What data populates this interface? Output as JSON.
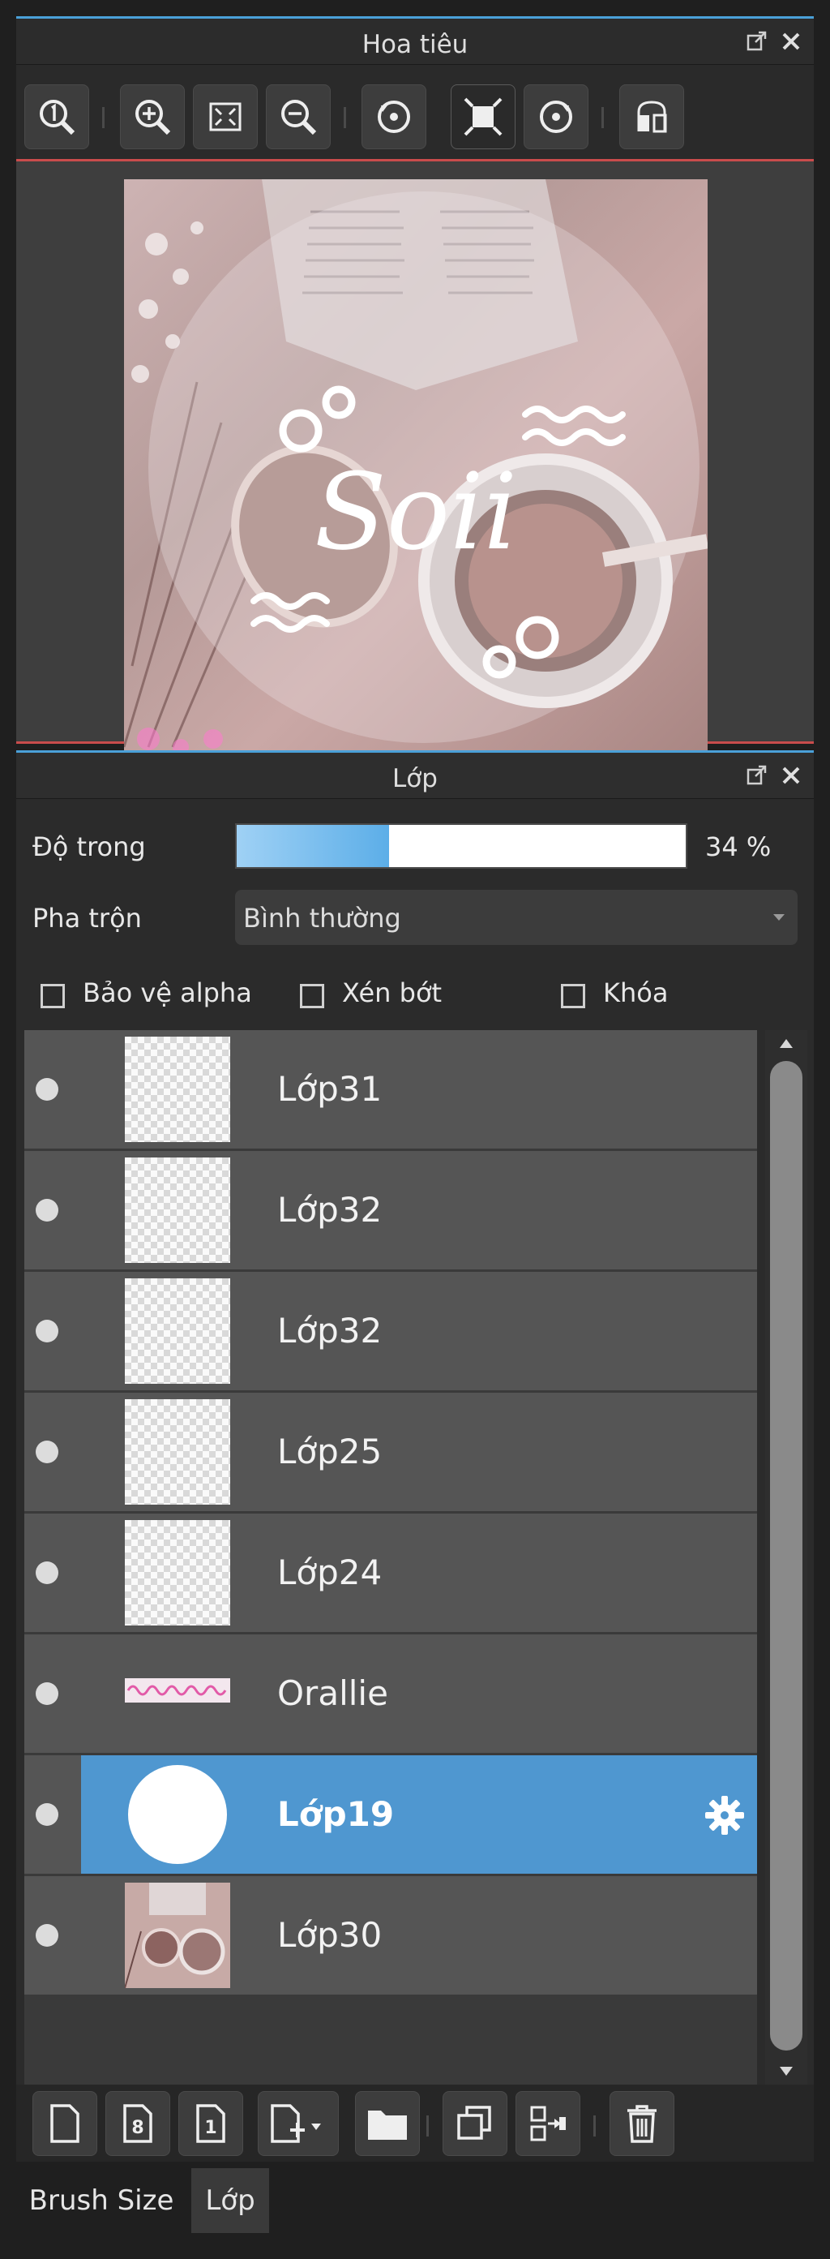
{
  "navigator": {
    "title": "Hoa tiêu",
    "preview_text": "Soii"
  },
  "layers_panel": {
    "title": "Lớp",
    "opacity_label": "Độ trong",
    "opacity_value": "34 %",
    "opacity_fraction": 0.34,
    "blend_label": "Pha trộn",
    "blend_value": "Bình thường",
    "checkboxes": [
      "Bảo vệ alpha",
      "Xén bớt",
      "Khóa"
    ],
    "layers": [
      {
        "name": "Lớp31",
        "selected": false
      },
      {
        "name": "Lớp32",
        "selected": false
      },
      {
        "name": "Lớp32",
        "selected": false
      },
      {
        "name": "Lớp25",
        "selected": false
      },
      {
        "name": "Lớp24",
        "selected": false
      },
      {
        "name": "Orallie",
        "selected": false
      },
      {
        "name": "Lớp19",
        "selected": true
      },
      {
        "name": "Lớp30",
        "selected": false
      }
    ]
  },
  "bottom_tabs": [
    "Brush Size",
    "Lớp"
  ],
  "colors": {
    "accent": "#4aa0d8",
    "selected_row": "#4f97d0",
    "panel": "#2b2b2b",
    "divider_red": "#c94c4c"
  }
}
